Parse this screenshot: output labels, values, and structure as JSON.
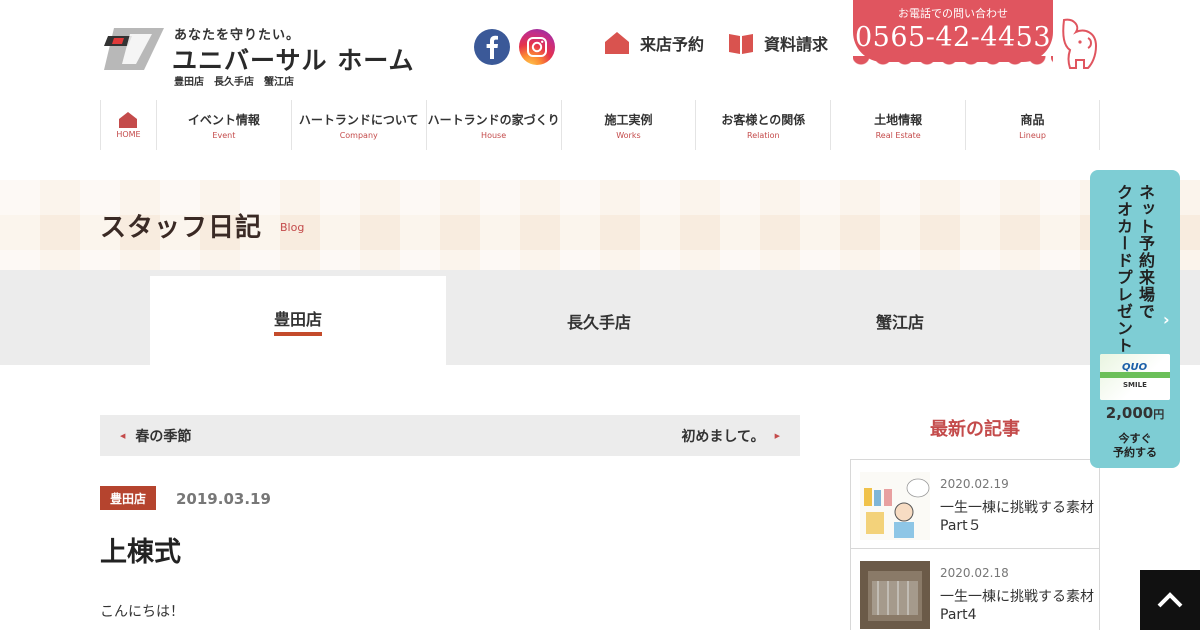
{
  "header": {
    "tagline": "あなたを守りたい。",
    "brand_name": "ユニバーサル ホーム",
    "branches": "豊田店　長久手店　蟹江店",
    "reserve_label": "来店予約",
    "docs_label": "資料請求",
    "tel_label": "お電話での問い合わせ",
    "tel_number": "0565-42-4453"
  },
  "nav": [
    {
      "ja": "",
      "en": "HOME"
    },
    {
      "ja": "イベント情報",
      "en": "Event"
    },
    {
      "ja": "ハートランドについて",
      "en": "Company"
    },
    {
      "ja": "ハートランドの家づくり",
      "en": "House"
    },
    {
      "ja": "施工実例",
      "en": "Works"
    },
    {
      "ja": "お客様との関係",
      "en": "Relation"
    },
    {
      "ja": "土地情報",
      "en": "Real Estate"
    },
    {
      "ja": "商品",
      "en": "Lineup"
    }
  ],
  "page": {
    "title": "スタッフ日記",
    "subtitle": "Blog"
  },
  "tabs": [
    {
      "label": "豊田店",
      "active": true
    },
    {
      "label": "長久手店",
      "active": false
    },
    {
      "label": "蟹江店",
      "active": false
    }
  ],
  "post_nav": {
    "prev_label": "春の季節",
    "next_label": "初めまして。"
  },
  "post": {
    "category": "豊田店",
    "date": "2019.03.19",
    "title": "上棟式",
    "body_first_line": "こんにちは！"
  },
  "sidebar": {
    "heading": "最新の記事",
    "items": [
      {
        "date": "2020.02.19",
        "title": "一生一棟に挑戦する素材　Part５"
      },
      {
        "date": "2020.02.18",
        "title": "一生一棟に挑戦する素材 Part4"
      }
    ]
  },
  "promo": {
    "text": "ネット予約来場で\nクオカードプレゼント",
    "card_brand": "QUO",
    "card_sub": "SMILE",
    "amount": "2,000",
    "amount_unit": "円",
    "cta": "今すぐ\n予約する"
  },
  "colors": {
    "accent": "#c44b4b",
    "tel_bg": "#e0555f",
    "badge_bg": "#b5442e",
    "promo_bg": "#7ecdd4",
    "facebook": "#3b5998"
  },
  "icons": {
    "home": "house-icon",
    "reserve": "house-icon",
    "docs": "book-icon",
    "pagetop": "chevron-up-icon"
  }
}
